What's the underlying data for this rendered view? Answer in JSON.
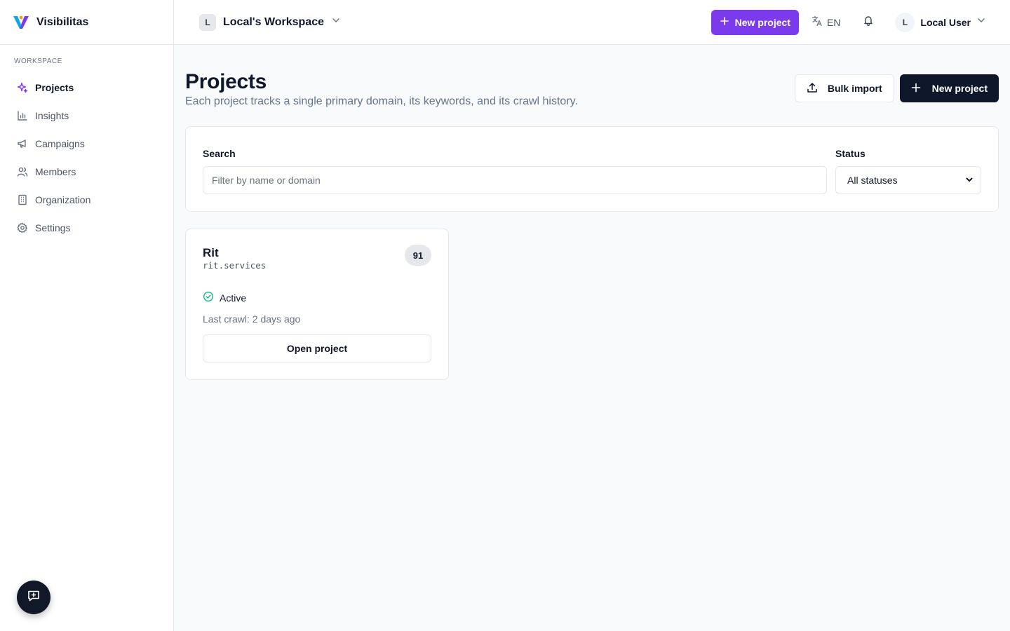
{
  "brand": {
    "name": "Visibilitas"
  },
  "sidebar": {
    "section_heading": "WORKSPACE",
    "items": [
      {
        "label": "Projects",
        "icon": "sparkles-icon",
        "active": true
      },
      {
        "label": "Insights",
        "icon": "bar-chart-icon"
      },
      {
        "label": "Campaigns",
        "icon": "megaphone-icon"
      },
      {
        "label": "Members",
        "icon": "users-icon"
      },
      {
        "label": "Organization",
        "icon": "building-icon"
      },
      {
        "label": "Settings",
        "icon": "gear-icon"
      }
    ]
  },
  "topbar": {
    "workspace_initial": "L",
    "workspace_name": "Local's Workspace",
    "new_project_label": "New project",
    "language": "EN",
    "user_initial": "L",
    "user_name": "Local User"
  },
  "page": {
    "title": "Projects",
    "subtitle": "Each project tracks a single primary domain, its keywords, and its crawl history.",
    "bulk_import_label": "Bulk import",
    "new_project_label": "New project"
  },
  "filters": {
    "search_label": "Search",
    "search_placeholder": "Filter by name or domain",
    "status_label": "Status",
    "status_value": "All statuses"
  },
  "projects": [
    {
      "name": "Rit",
      "domain": "rit.services",
      "score": "91",
      "status": "Active",
      "last_crawl": "Last crawl: 2 days ago",
      "open_label": "Open project"
    }
  ],
  "colors": {
    "accent_purple": "#7c3aed",
    "dark_button": "#0f172a",
    "active_green": "#10b981"
  }
}
